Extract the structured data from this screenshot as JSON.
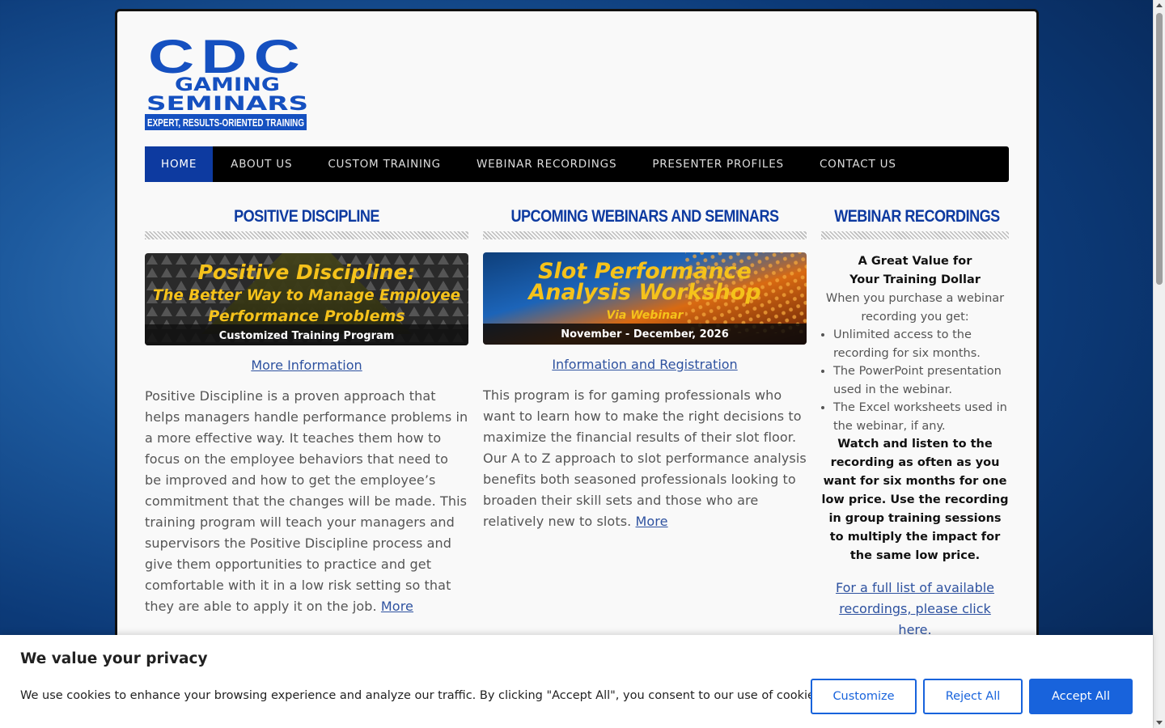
{
  "logo": {
    "line1": "CDC",
    "line2": "GAMING",
    "line3": "SEMINARS",
    "tagline": "EXPERT, RESULTS-ORIENTED TRAINING",
    "color": "#1550c0"
  },
  "nav": {
    "items": [
      {
        "label": "HOME",
        "active": true
      },
      {
        "label": "ABOUT US"
      },
      {
        "label": "CUSTOM TRAINING"
      },
      {
        "label": "WEBINAR RECORDINGS"
      },
      {
        "label": "PRESENTER PROFILES"
      },
      {
        "label": "CONTACT US"
      }
    ]
  },
  "col1": {
    "title": "POSITIVE DISCIPLINE",
    "banner": {
      "line1": "Positive Discipline:",
      "line2": "The Better Way to Manage Employee",
      "line3": "Performance Problems",
      "line4": "Customized Training Program"
    },
    "link": "More Information",
    "body": "Positive Discipline is a proven approach that helps managers handle performance problems in a more effective way. It teaches them how to focus on the employee behaviors that need to be improved and how to get the employee’s commitment that the changes will be made. This training program will teach your managers and supervisors the Positive Discipline process and give them opportunities to practice and get comfortable with it in a low risk setting so that they are able to apply it on the job.",
    "more": "More"
  },
  "col2": {
    "title": "UPCOMING WEBINARS AND SEMINARS",
    "banner": {
      "line1": "Slot Performance",
      "line2": "Analysis Workshop",
      "line3": "Via Webinar",
      "line4": "November - December, 2026"
    },
    "link": "Information and Registration",
    "body": "This program is for gaming professionals who want to learn how to make the right decisions to maximize the financial results of their slot floor. Our A to Z approach to slot performance analysis benefits both seasoned professionals looking to broaden their skill sets and those who are relatively new to slots.",
    "more": "More"
  },
  "col3": {
    "title": "WEBINAR RECORDINGS",
    "head1": "A Great Value for",
    "head2": "Your Training Dollar",
    "sub": "When you purchase a webinar recording you get:",
    "list": [
      "Unlimited access to the recording for six months.",
      "The PowerPoint presentation used in the webinar.",
      "The Excel worksheets used in the webinar, if any."
    ],
    "bold": "Watch and listen to the recording as often as you want for six months for one low price. Use the recording in group training sessions to multiply the impact for the same low price.",
    "link": "For a full list of available recordings, please click here."
  },
  "cookie": {
    "title": "We value your privacy",
    "text": "We use cookies to enhance your browsing experience and analyze our traffic. By clicking \"Accept All\", you consent to our use of cookies.",
    "customize": "Customize",
    "reject": "Reject All",
    "accept": "Accept All",
    "accent": "#1863dc"
  }
}
